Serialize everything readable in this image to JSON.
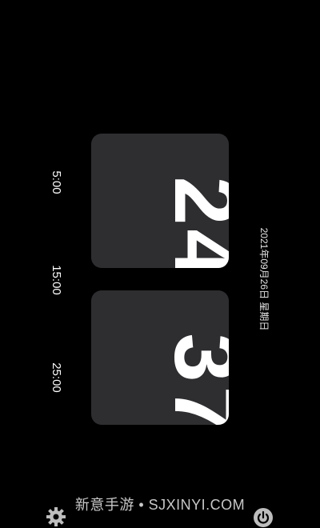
{
  "clock": {
    "hours": [
      "2",
      "4"
    ],
    "minutes": [
      "3",
      "7"
    ]
  },
  "alarms": [
    "5:00",
    "15:00",
    "25:00"
  ],
  "date": "2021年09月26日  星期日",
  "watermark": "新意手游 • SJXINYI.COM",
  "colors": {
    "background": "#000000",
    "card": "#2e2d30",
    "text": "#ffffff"
  },
  "icons": {
    "bottom_left": "gear-icon",
    "bottom_right": "round-button-icon"
  }
}
